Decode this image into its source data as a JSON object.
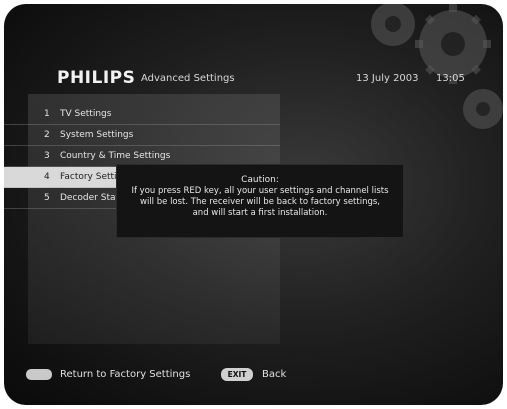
{
  "header": {
    "brand": "PHILIPS",
    "title": "Advanced Settings",
    "date": "13 July 2003",
    "time": "13:05"
  },
  "menu": {
    "items": [
      {
        "number": "1",
        "label": "TV Settings"
      },
      {
        "number": "2",
        "label": "System Settings"
      },
      {
        "number": "3",
        "label": "Country & Time Settings"
      },
      {
        "number": "4",
        "label": "Factory Settings",
        "selected": true
      },
      {
        "number": "5",
        "label": "Decoder Status"
      }
    ]
  },
  "dialog": {
    "title": "Caution:",
    "lines": [
      "If you press RED key, all your user settings and channel lists",
      "will be lost. The receiver will be back to factory settings,",
      "and will start a first installation."
    ]
  },
  "footer": {
    "red_action": "Return to Factory Settings",
    "exit_key": "EXIT",
    "exit_action": "Back"
  },
  "colors": {
    "background": "#151515",
    "selected_bg": "#d9d9d9",
    "dialog_bg": "#141414",
    "text": "#e6e6e6"
  }
}
